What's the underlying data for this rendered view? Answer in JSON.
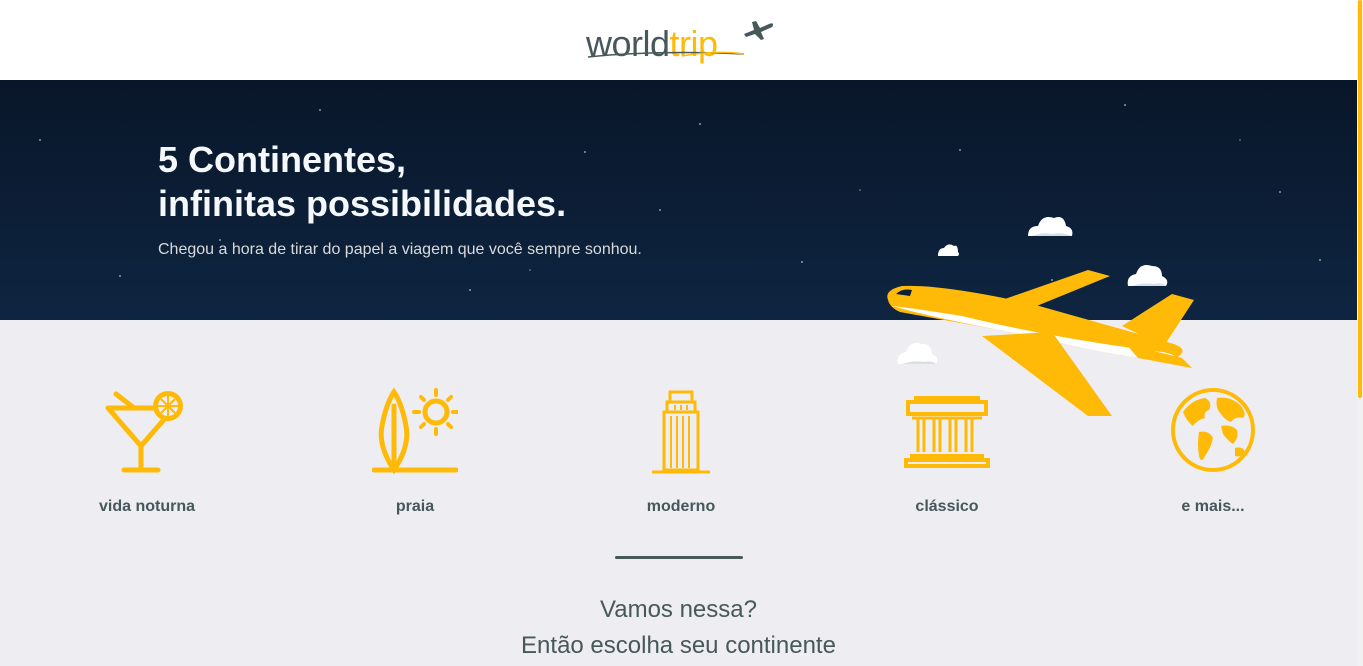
{
  "header": {
    "logo_world": "world",
    "logo_trip": "trip",
    "logo_icon": "airplane-icon"
  },
  "hero": {
    "title_line1": "5 Continentes,",
    "title_line2": "infinitas possibilidades.",
    "subtitle": "Chegou a hora de tirar do papel a viagem que você sempre sonhou.",
    "illustration": "airplane-with-clouds"
  },
  "categories": [
    {
      "label": "vida noturna",
      "icon": "cocktail-icon"
    },
    {
      "label": "praia",
      "icon": "surfboard-sun-icon"
    },
    {
      "label": "moderno",
      "icon": "skyscraper-icon"
    },
    {
      "label": "clássico",
      "icon": "museum-icon"
    },
    {
      "label": "e mais...",
      "icon": "globe-icon"
    }
  ],
  "cta": {
    "line1": "Vamos nessa?",
    "line2": "Então escolha seu continente"
  },
  "colors": {
    "accent": "#ffba08",
    "text": "#47585b",
    "hero_bg": "#0c1f38",
    "page_bg": "#eeedf2"
  }
}
